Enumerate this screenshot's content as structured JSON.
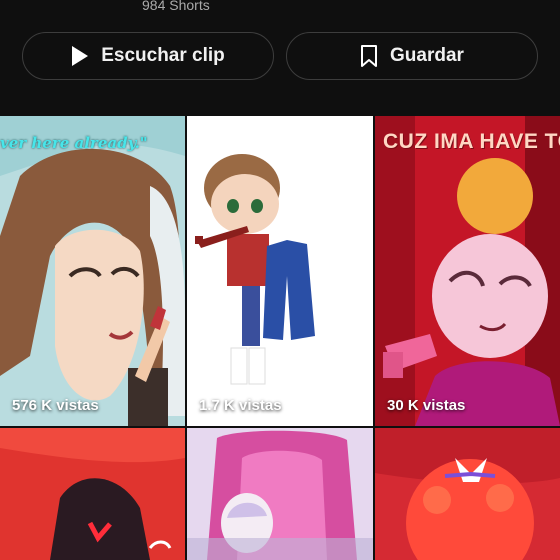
{
  "channel": {
    "shorts_count": "984 Shorts"
  },
  "actions": {
    "listen_label": "Escuchar clip",
    "save_label": "Guardar"
  },
  "tiles": [
    {
      "views": "576 K vistas",
      "caption": "ver here already.\""
    },
    {
      "views": "1.7 K vistas",
      "caption": ""
    },
    {
      "views": "30 K vistas",
      "caption": "CUZ IMA HAVE TO"
    },
    {
      "views": "",
      "caption": ""
    },
    {
      "views": "",
      "caption": ""
    },
    {
      "views": "",
      "caption": ""
    }
  ],
  "icons": {
    "listen": "play-icon",
    "save": "bookmark-icon"
  },
  "colors": {
    "background": "#0f0f0f",
    "pill_border": "#3d3d3d",
    "secondary_text": "#aaaaaa"
  }
}
